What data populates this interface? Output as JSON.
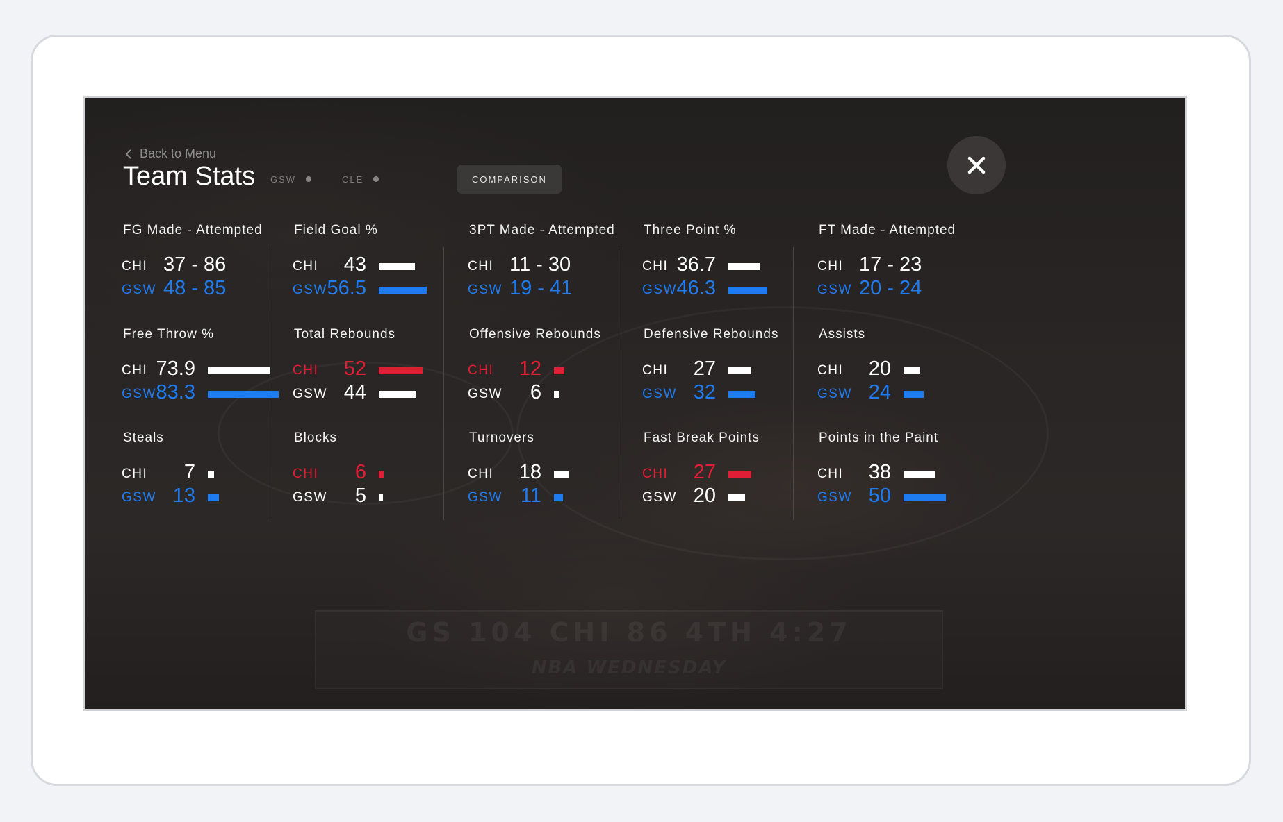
{
  "header": {
    "back_label": "Back to Menu",
    "title": "Team Stats",
    "tabs": [
      {
        "label": "GSW"
      },
      {
        "label": "CLE"
      },
      {
        "label": "COMPARISON",
        "active": true
      }
    ]
  },
  "background": {
    "scorebug": "GS 104   CHI 86   4TH 4:27",
    "scorebug_sub": "NBA WEDNESDAY"
  },
  "colors": {
    "chi_default": "#ffffff",
    "gsw": "#1f7bf0",
    "leader_red": "#e01e35"
  },
  "stats": [
    {
      "title": "FG Made - Attempted",
      "chi_label": "CHI",
      "chi_value": "37 - 86",
      "gsw_label": "GSW",
      "gsw_value": "48 - 85",
      "type": "text"
    },
    {
      "title": "Field Goal %",
      "chi_label": "CHI",
      "chi_value": "43",
      "gsw_label": "GSW",
      "gsw_value": "56.5",
      "chi_num": 43,
      "gsw_num": 56.5,
      "leader": "gsw"
    },
    {
      "title": "3PT Made - Attempted",
      "chi_label": "CHI",
      "chi_value": "11 - 30",
      "gsw_label": "GSW",
      "gsw_value": "19 - 41",
      "type": "text"
    },
    {
      "title": "Three Point %",
      "chi_label": "CHI",
      "chi_value": "36.7",
      "gsw_label": "GSW",
      "gsw_value": "46.3",
      "chi_num": 36.7,
      "gsw_num": 46.3,
      "leader": "gsw"
    },
    {
      "title": "FT Made - Attempted",
      "chi_label": "CHI",
      "chi_value": "17 - 23",
      "gsw_label": "GSW",
      "gsw_value": "20 - 24",
      "type": "text"
    },
    {
      "title": "Free Throw %",
      "chi_label": "CHI",
      "chi_value": "73.9",
      "gsw_label": "GSW",
      "gsw_value": "83.3",
      "chi_num": 73.9,
      "gsw_num": 83.3,
      "leader": "gsw"
    },
    {
      "title": "Total Rebounds",
      "chi_label": "CHI",
      "chi_value": "52",
      "gsw_label": "GSW",
      "gsw_value": "44",
      "chi_num": 52,
      "gsw_num": 44,
      "leader": "chi"
    },
    {
      "title": "Offensive Rebounds",
      "chi_label": "CHI",
      "chi_value": "12",
      "gsw_label": "GSW",
      "gsw_value": "6",
      "chi_num": 12,
      "gsw_num": 6,
      "leader": "chi"
    },
    {
      "title": "Defensive Rebounds",
      "chi_label": "CHI",
      "chi_value": "27",
      "gsw_label": "GSW",
      "gsw_value": "32",
      "chi_num": 27,
      "gsw_num": 32,
      "leader": "gsw"
    },
    {
      "title": "Assists",
      "chi_label": "CHI",
      "chi_value": "20",
      "gsw_label": "GSW",
      "gsw_value": "24",
      "chi_num": 20,
      "gsw_num": 24,
      "leader": "gsw"
    },
    {
      "title": "Steals",
      "chi_label": "CHI",
      "chi_value": "7",
      "gsw_label": "GSW",
      "gsw_value": "13",
      "chi_num": 7,
      "gsw_num": 13,
      "leader": "gsw"
    },
    {
      "title": "Blocks",
      "chi_label": "CHI",
      "chi_value": "6",
      "gsw_label": "GSW",
      "gsw_value": "5",
      "chi_num": 6,
      "gsw_num": 5,
      "leader": "chi"
    },
    {
      "title": "Turnovers",
      "chi_label": "CHI",
      "chi_value": "18",
      "gsw_label": "GSW",
      "gsw_value": "11",
      "chi_num": 18,
      "gsw_num": 11,
      "leader": "gsw"
    },
    {
      "title": "Fast Break Points",
      "chi_label": "CHI",
      "chi_value": "27",
      "gsw_label": "GSW",
      "gsw_value": "20",
      "chi_num": 27,
      "gsw_num": 20,
      "leader": "chi"
    },
    {
      "title": "Points in the Paint",
      "chi_label": "CHI",
      "chi_value": "38",
      "gsw_label": "GSW",
      "gsw_value": "50",
      "chi_num": 38,
      "gsw_num": 50,
      "leader": "gsw"
    }
  ]
}
